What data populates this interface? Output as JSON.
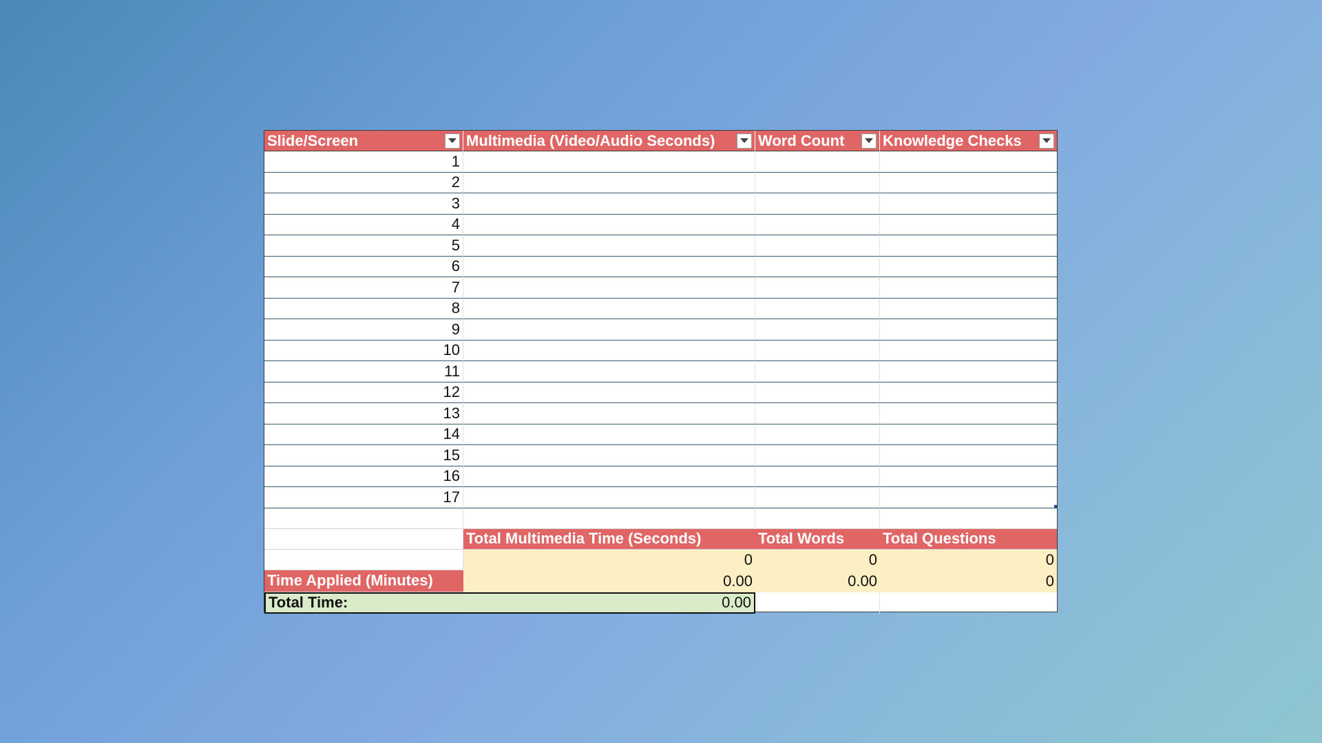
{
  "table": {
    "headers": [
      "Slide/Screen",
      "Multimedia (Video/Audio Seconds)",
      "Word Count",
      "Knowledge Checks"
    ],
    "rows": [
      "1",
      "2",
      "3",
      "4",
      "5",
      "6",
      "7",
      "8",
      "9",
      "10",
      "11",
      "12",
      "13",
      "14",
      "15",
      "16",
      "17"
    ]
  },
  "totals": {
    "labels": [
      "Total Multimedia Time (Seconds)",
      "Total Words",
      "Total Questions"
    ],
    "values": [
      "0",
      "0",
      "0"
    ],
    "time_applied_label": "Time Applied (Minutes)",
    "time_applied_values": [
      "0.00",
      "0.00",
      "0"
    ],
    "total_time_label": "Total Time:",
    "total_time_value": "0.00"
  },
  "colors": {
    "header": "#e06666",
    "input": "#fdefc4",
    "total": "#d9ebc9"
  },
  "icons": {
    "filter": "chevron-down-icon"
  }
}
